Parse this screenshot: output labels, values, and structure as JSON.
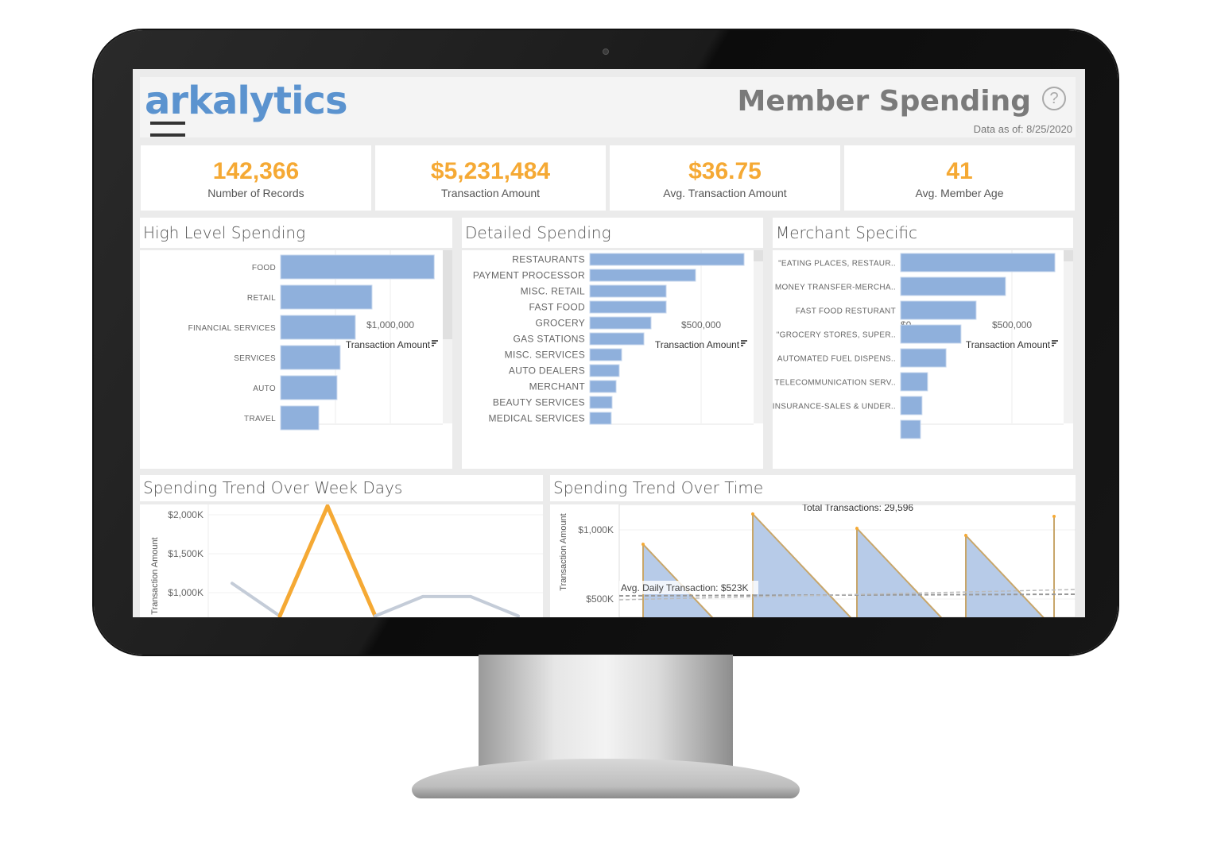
{
  "header": {
    "logo": "arkalytics",
    "title": "Member Spending",
    "help_icon": "question-circle-icon",
    "data_as_of_label": "Data as of:",
    "data_as_of": "8/25/2020"
  },
  "kpis": [
    {
      "value": "142,366",
      "label": "Number of Records"
    },
    {
      "value": "$5,231,484",
      "label": "Transaction Amount"
    },
    {
      "value": "$36.75",
      "label": "Avg. Transaction Amount"
    },
    {
      "value": "41",
      "label": "Avg. Member Age"
    }
  ],
  "colors": {
    "accent": "#f5a934",
    "bar": "#8fb0dc",
    "logo": "#5b93cf"
  },
  "panels": {
    "high": "High Level Spending",
    "detailed": "Detailed Spending",
    "merchant": "Merchant Specific",
    "week": "Spending Trend Over Week Days",
    "time": "Spending Trend Over Time"
  },
  "chart_data": [
    {
      "type": "bar",
      "orientation": "horizontal",
      "categories": [
        "FOOD",
        "RETAIL",
        "FINANCIAL SERVICES",
        "SERVICES",
        "AUTO",
        "TRAVEL"
      ],
      "values": [
        1400000,
        833000,
        681000,
        543000,
        514000,
        348000
      ],
      "xlabel": "Transaction Amount",
      "xticks": [
        "$0",
        "$500,000",
        "$1,000,000"
      ],
      "xlim": [
        0,
        1450000
      ]
    },
    {
      "type": "bar",
      "orientation": "horizontal",
      "categories": [
        "RESTAURANTS",
        "PAYMENT PROCESSOR",
        "MISC. RETAIL",
        "FAST FOOD",
        "GROCERY",
        "GAS STATIONS",
        "MISC. SERVICES",
        "AUTO DEALERS",
        "MERCHANT",
        "BEAUTY SERVICES",
        "MEDICAL SERVICES"
      ],
      "values": [
        693000,
        475000,
        343000,
        343000,
        275000,
        243000,
        143000,
        132000,
        118000,
        100000,
        96000
      ],
      "xlabel": "Transaction Amount",
      "xticks": [
        "$0",
        "$500,000"
      ],
      "xlim": [
        0,
        730000
      ]
    },
    {
      "type": "bar",
      "orientation": "horizontal",
      "categories": [
        "\"EATING PLACES, RESTAUR..",
        "MONEY TRANSFER-MERCHA..",
        "FAST FOOD RESTURANT",
        "\"GROCERY STORES, SUPER..",
        "AUTOMATED FUEL DISPENS..",
        "TELECOMMUNICATION SERV..",
        "INSURANCE-SALES & UNDER..",
        ""
      ],
      "values": [
        693000,
        471000,
        339000,
        271000,
        204000,
        121000,
        96000,
        89000
      ],
      "xlabel": "Transaction Amount",
      "xticks": [
        "$0",
        "$500,000"
      ],
      "xlim": [
        0,
        730000
      ]
    },
    {
      "type": "line",
      "ylabel": "Transaction Amount",
      "yticks": [
        "$1,000K",
        "$1,500K",
        "$2,000K"
      ],
      "values": [
        1120,
        700,
        2110,
        700,
        950,
        950,
        700
      ],
      "yunit": "K"
    },
    {
      "type": "area",
      "ylabel": "Transaction Amount",
      "yticks": [
        "$500K",
        "$1,000K"
      ],
      "peaks": [
        896,
        1115,
        1011,
        960,
        1098
      ],
      "yunit": "K",
      "avg": 523,
      "avg_label": "Avg. Daily Transaction: $523K",
      "total_label": "Total Transactions: 29,596"
    }
  ]
}
